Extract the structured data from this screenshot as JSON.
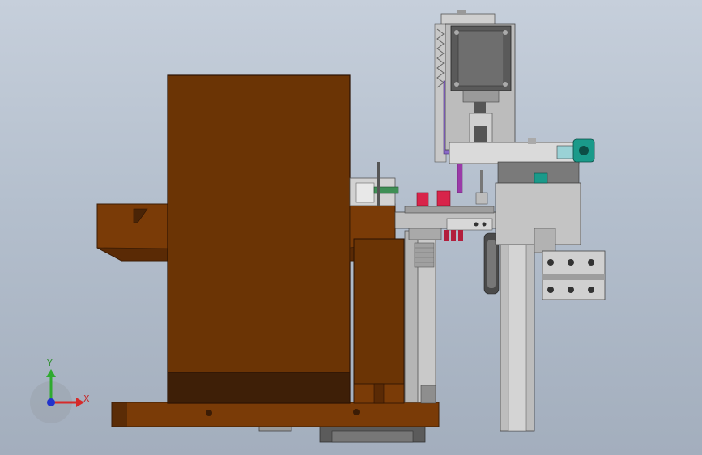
{
  "viewport": {
    "background_top": "#c6cfdb",
    "background_bottom": "#a3aebd"
  },
  "triad": {
    "x_label": "X",
    "y_label": "Y",
    "x_color": "#d62a2a",
    "y_color": "#2faa2f",
    "z_color": "#2233cc"
  },
  "colors": {
    "wood": "#6b3405",
    "wood_dark": "#3e1f07",
    "wood_edge": "#4a2406",
    "steel": "#b8b8b8",
    "steel_dark": "#8a8a8a",
    "motor_dark": "#5a5a5a",
    "accent_teal": "#1a9a8a",
    "accent_red": "#d8244a",
    "accent_purple": "#9a3aa8"
  }
}
